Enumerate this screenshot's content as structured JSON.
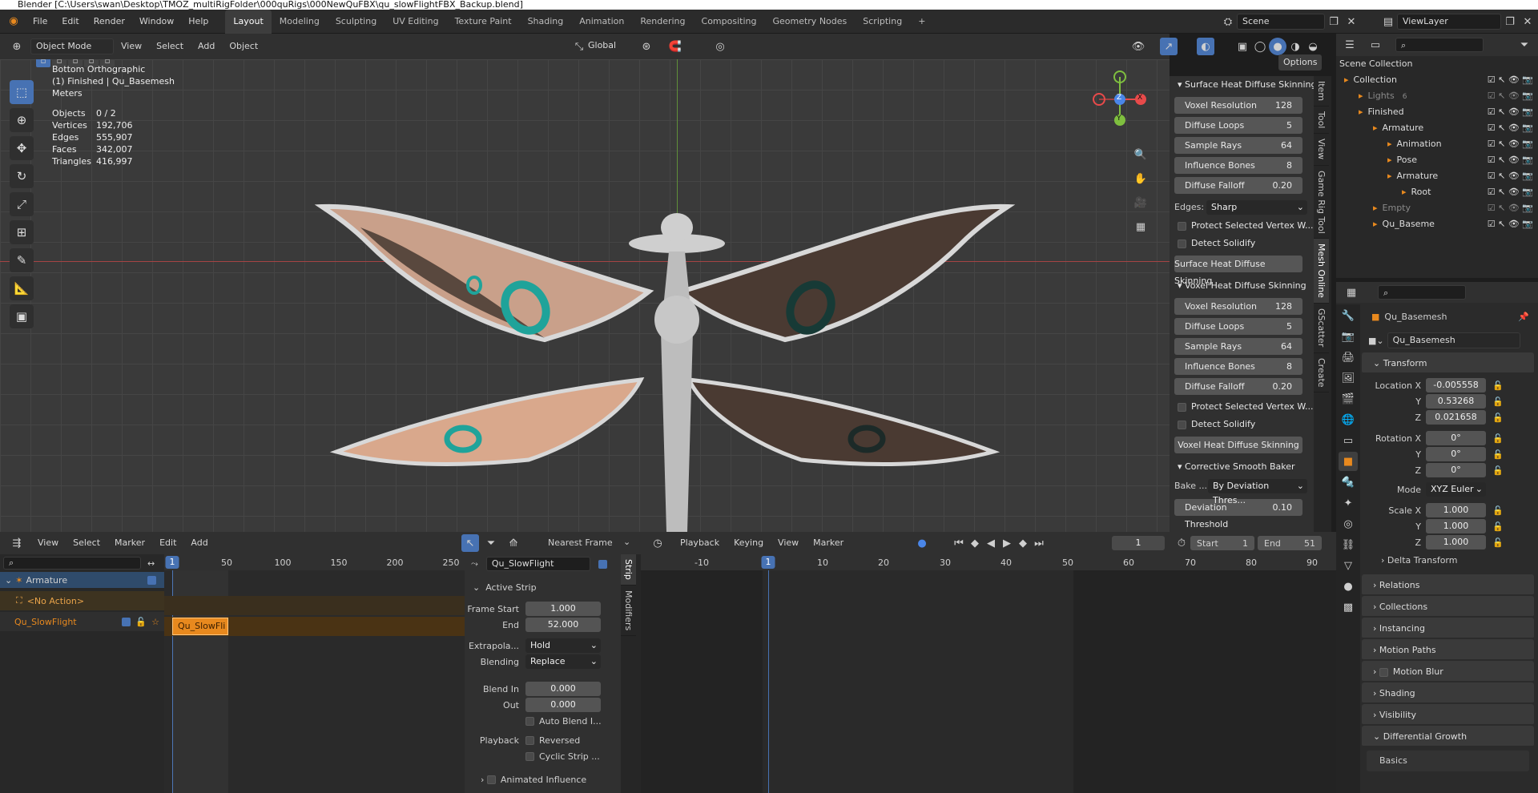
{
  "titlebar": {
    "text": "Blender  [C:\\Users\\swan\\Desktop\\TMOZ_multiRigFolder\\000quRigs\\000NewQuFBX\\qu_slowFlightFBX_Backup.blend]"
  },
  "menu": [
    "File",
    "Edit",
    "Render",
    "Window",
    "Help"
  ],
  "workspaces": [
    "Layout",
    "Modeling",
    "Sculpting",
    "UV Editing",
    "Texture Paint",
    "Shading",
    "Animation",
    "Rendering",
    "Compositing",
    "Geometry Nodes",
    "Scripting",
    "+"
  ],
  "scene": {
    "name": "Scene",
    "view_layer": "ViewLayer"
  },
  "viewport": {
    "mode": "Object Mode",
    "menus": [
      "View",
      "Select",
      "Add",
      "Object"
    ],
    "orientation": "Global",
    "options": "Options",
    "view_name": "Bottom Orthographic",
    "collection_info": "(1) Finished | Qu_Basemesh",
    "units": "Meters",
    "stats": [
      {
        "label": "Objects",
        "value": "0 / 2"
      },
      {
        "label": "Vertices",
        "value": "192,706"
      },
      {
        "label": "Edges",
        "value": "555,907"
      },
      {
        "label": "Faces",
        "value": "342,007"
      },
      {
        "label": "Triangles",
        "value": "416,997"
      }
    ],
    "gizmo": {
      "x": "X",
      "y": "Y",
      "z": "Z"
    }
  },
  "npanel": {
    "surface": {
      "title": "Surface Heat Diffuse Skinning",
      "fields": [
        {
          "label": "Voxel Resolution",
          "value": "128"
        },
        {
          "label": "Diffuse Loops",
          "value": "5"
        },
        {
          "label": "Sample Rays",
          "value": "64"
        },
        {
          "label": "Influence Bones",
          "value": "8"
        },
        {
          "label": "Diffuse Falloff",
          "value": "0.20"
        }
      ],
      "edges_label": "Edges:",
      "edges_value": "Sharp",
      "protect": "Protect Selected Vertex W...",
      "detect": "Detect Solidify",
      "run": "Surface Heat Diffuse Skinning"
    },
    "voxel": {
      "title": "Voxel Heat Diffuse Skinning",
      "fields": [
        {
          "label": "Voxel Resolution",
          "value": "128"
        },
        {
          "label": "Diffuse Loops",
          "value": "5"
        },
        {
          "label": "Sample Rays",
          "value": "64"
        },
        {
          "label": "Influence Bones",
          "value": "8"
        },
        {
          "label": "Diffuse Falloff",
          "value": "0.20"
        }
      ],
      "protect": "Protect Selected Vertex W...",
      "detect": "Detect Solidify",
      "run": "Voxel Heat Diffuse Skinning"
    },
    "corrective": {
      "title": "Corrective Smooth Baker",
      "bake_label": "Bake ...",
      "bake_value": "By Deviation Thres...",
      "threshold_label": "Deviation Threshold",
      "threshold_value": "0.10"
    },
    "tabs": [
      "Item",
      "Tool",
      "View",
      "Game Rig Tool",
      "Mesh Online",
      "GScatter",
      "Create"
    ]
  },
  "outliner": {
    "header": "Scene Collection",
    "items": [
      {
        "label": "Collection",
        "indent": 0
      },
      {
        "label": "Lights",
        "indent": 1,
        "badge": "6"
      },
      {
        "label": "Finished",
        "indent": 1
      },
      {
        "label": "Armature",
        "indent": 2
      },
      {
        "label": "Animation",
        "indent": 3
      },
      {
        "label": "Pose",
        "indent": 3
      },
      {
        "label": "Armature",
        "indent": 3
      },
      {
        "label": "Root",
        "indent": 4
      },
      {
        "label": "Empty",
        "indent": 2
      },
      {
        "label": "Qu_Baseme",
        "indent": 2
      }
    ]
  },
  "properties": {
    "object_name": "Qu_Basemesh",
    "datablock": "Qu_Basemesh",
    "transform": {
      "title": "Transform",
      "location": [
        {
          "label": "Location X",
          "value": "-0.005558"
        },
        {
          "label": "Y",
          "value": "0.53268"
        },
        {
          "label": "Z",
          "value": "0.021658"
        }
      ],
      "rotation": [
        {
          "label": "Rotation X",
          "value": "0°"
        },
        {
          "label": "Y",
          "value": "0°"
        },
        {
          "label": "Z",
          "value": "0°"
        }
      ],
      "mode_label": "Mode",
      "mode_value": "XYZ Euler",
      "scale": [
        {
          "label": "Scale X",
          "value": "1.000"
        },
        {
          "label": "Y",
          "value": "1.000"
        },
        {
          "label": "Z",
          "value": "1.000"
        }
      ],
      "delta": "Delta Transform"
    },
    "sections": [
      "Relations",
      "Collections",
      "Instancing",
      "Motion Paths",
      "Motion Blur",
      "Shading",
      "Visibility",
      "Differential Growth"
    ],
    "basics": "Basics"
  },
  "nla": {
    "menus": [
      "View",
      "Select",
      "Marker",
      "Edit",
      "Add"
    ],
    "snap": "Nearest Frame",
    "armature": "Armature",
    "no_action": "<No Action>",
    "track": "Qu_SlowFlight",
    "strip_label": "Qu_SlowFli",
    "ruler": [
      "50",
      "100",
      "150",
      "200",
      "250"
    ],
    "current_frame": "1"
  },
  "strip": {
    "action": "Qu_SlowFlight",
    "section": "Active Strip",
    "frame_start_label": "Frame Start",
    "frame_start": "1.000",
    "end_label": "End",
    "end": "52.000",
    "extrapolation_label": "Extrapola...",
    "extrapolation": "Hold",
    "blending_label": "Blending",
    "blending": "Replace",
    "blend_in_label": "Blend In",
    "blend_in": "0.000",
    "out_label": "Out",
    "out": "0.000",
    "auto_blend": "Auto Blend I...",
    "playback_label": "Playback",
    "reversed": "Reversed",
    "cyclic": "Cyclic Strip ...",
    "animated": "Animated Influence",
    "tabs": [
      "Strip",
      "Modifiers"
    ]
  },
  "timeline": {
    "menus": [
      "Playback",
      "Keying",
      "View",
      "Marker"
    ],
    "frame": "1",
    "start_label": "Start",
    "start": "1",
    "end_label": "End",
    "end": "51",
    "ruler": [
      "-10",
      "1",
      "10",
      "20",
      "30",
      "40",
      "50",
      "60",
      "70",
      "80",
      "90"
    ],
    "current_frame": "1"
  },
  "colors": {
    "accent": "#4772b3",
    "orange": "#e8891e",
    "axis_x": "#e84a4a",
    "axis_y": "#7fbf3f",
    "axis_z": "#4a86e8"
  }
}
